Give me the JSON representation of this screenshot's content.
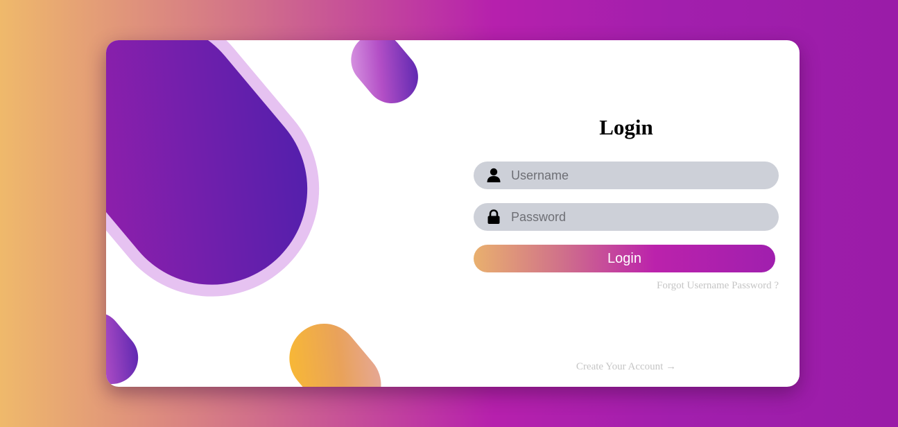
{
  "form": {
    "title": "Login",
    "username_placeholder": "Username",
    "password_placeholder": "Password",
    "login_label": "Login",
    "forgot_label": "Forgot Username Password ?",
    "create_account_label": "Create Your Account →"
  },
  "icons": {
    "username": "user-icon",
    "password": "lock-icon"
  },
  "colors": {
    "background_start": "#efb96b",
    "background_end": "#9a1ca8",
    "accent_purple": "#a01fae",
    "field_background": "#cdd0d8",
    "link_gray": "#c5c5c5"
  }
}
